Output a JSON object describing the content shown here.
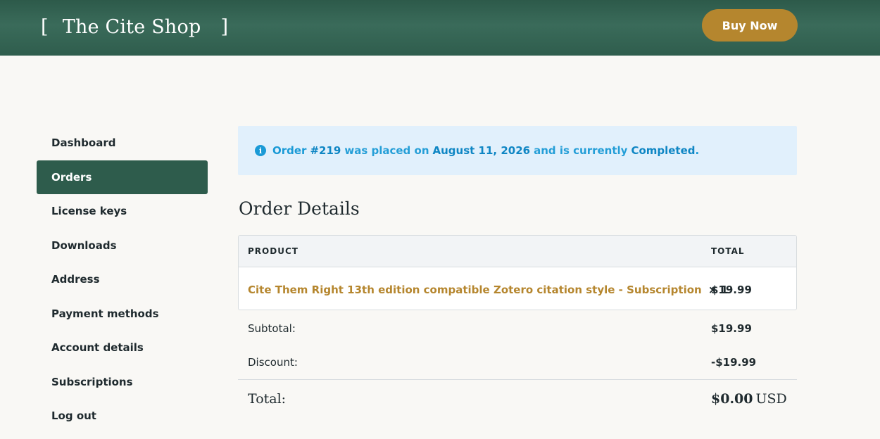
{
  "header": {
    "bracket_open": "[",
    "site_name": "The Cite Shop",
    "bracket_close": "]",
    "buy_button": "Buy Now"
  },
  "sidebar": {
    "items": [
      {
        "label": "Dashboard"
      },
      {
        "label": "Orders"
      },
      {
        "label": "License keys"
      },
      {
        "label": "Downloads"
      },
      {
        "label": "Address"
      },
      {
        "label": "Payment methods"
      },
      {
        "label": "Account details"
      },
      {
        "label": "Subscriptions"
      },
      {
        "label": "Log out"
      }
    ],
    "active": "Orders"
  },
  "notice": {
    "icon": "info-icon",
    "prefix": "Order",
    "order_number": "#219",
    "mid1": "was placed on",
    "date": "August 11, 2026",
    "mid2": "and is currently",
    "status": "Completed",
    "end": "."
  },
  "order_details": {
    "title": "Order Details",
    "columns": [
      "PRODUCT",
      "TOTAL"
    ],
    "items": [
      {
        "product": "Cite Them Right 13th edition compatible Zotero citation style - Subscription",
        "quantity": "× 1",
        "total": "$19.99"
      }
    ],
    "subtotal_label": "Subtotal:",
    "subtotal": "$19.99",
    "discount_label": "Discount:",
    "discount": "-$19.99",
    "total_label": "Total:",
    "total": "$0.00",
    "currency": "USD"
  },
  "colors": {
    "header_green": "#2e5c4c",
    "accent_gold": "#b5862e",
    "notice_blue": "#1a9ad6",
    "notice_bg": "#e1f0fc"
  }
}
